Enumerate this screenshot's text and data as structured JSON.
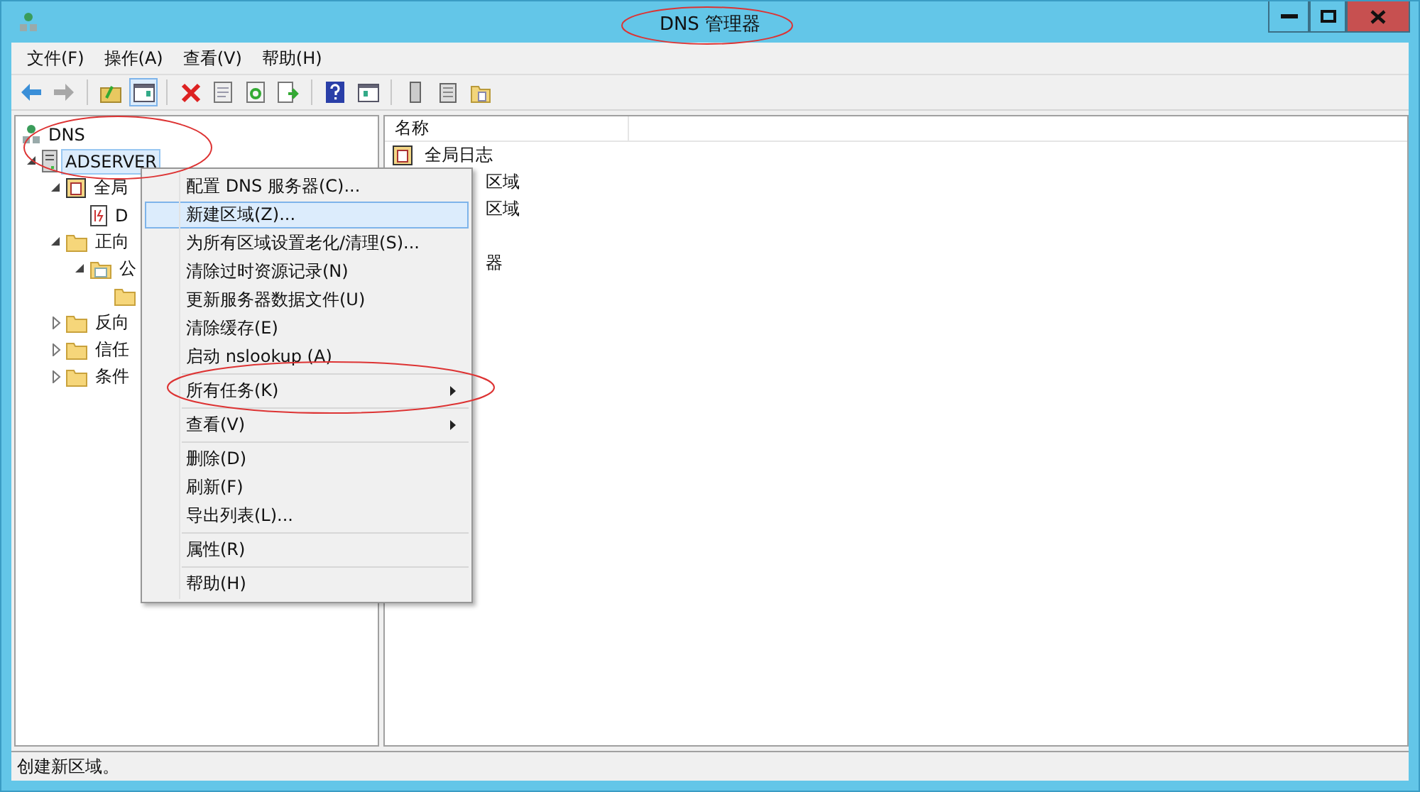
{
  "window": {
    "title": "DNS 管理器"
  },
  "menubar": [
    "文件(F)",
    "操作(A)",
    "查看(V)",
    "帮助(H)"
  ],
  "toolbar": [
    {
      "kind": "back",
      "disabled": false
    },
    {
      "kind": "forward",
      "disabled": true
    },
    {
      "kind": "sep"
    },
    {
      "kind": "up",
      "disabled": false
    },
    {
      "kind": "pane",
      "disabled": false,
      "selected": true
    },
    {
      "kind": "sep"
    },
    {
      "kind": "delete",
      "disabled": false
    },
    {
      "kind": "props",
      "disabled": false
    },
    {
      "kind": "refresh",
      "disabled": false
    },
    {
      "kind": "export",
      "disabled": false
    },
    {
      "kind": "sep"
    },
    {
      "kind": "help",
      "disabled": false
    },
    {
      "kind": "pane2",
      "disabled": false
    },
    {
      "kind": "sep"
    },
    {
      "kind": "server",
      "disabled": false
    },
    {
      "kind": "list",
      "disabled": false
    },
    {
      "kind": "folders",
      "disabled": false
    }
  ],
  "tree": [
    {
      "kind": "dns",
      "label": "DNS",
      "selected": false,
      "children": [
        {
          "kind": "server",
          "label": "ADSERVER",
          "selected": true,
          "expanded": true,
          "children": [
            {
              "kind": "log",
              "label": "全局",
              "expanded": true,
              "children": [
                {
                  "kind": "logfile",
                  "label": "D"
                }
              ]
            },
            {
              "kind": "folder",
              "label": "正向",
              "expanded": true,
              "children": [
                {
                  "kind": "zone",
                  "label": "公",
                  "expanded": true,
                  "children": [
                    {
                      "kind": "folder"
                    }
                  ]
                }
              ]
            },
            {
              "kind": "folder",
              "label": "反向",
              "expanded": false
            },
            {
              "kind": "folder",
              "label": "信任",
              "expanded": false
            },
            {
              "kind": "folder",
              "label": "条件",
              "expanded": false
            }
          ]
        }
      ]
    }
  ],
  "list": {
    "columns": [
      "名称"
    ],
    "rows": [
      {
        "kind": "log",
        "label": "全局日志"
      },
      {
        "kind": "none",
        "label": "区域"
      },
      {
        "kind": "none",
        "label": "区域"
      },
      {
        "kind": "gap"
      },
      {
        "kind": "none",
        "label": "器"
      }
    ]
  },
  "context_menu": [
    {
      "kind": "item",
      "label": "配置 DNS 服务器(C)...",
      "selected": false,
      "submenu": false
    },
    {
      "kind": "item",
      "label": "新建区域(Z)...",
      "selected": true,
      "submenu": false
    },
    {
      "kind": "item",
      "label": "为所有区域设置老化/清理(S)...",
      "selected": false,
      "submenu": false
    },
    {
      "kind": "item",
      "label": "清除过时资源记录(N)",
      "selected": false,
      "submenu": false
    },
    {
      "kind": "item",
      "label": "更新服务器数据文件(U)",
      "selected": false,
      "submenu": false
    },
    {
      "kind": "item",
      "label": "清除缓存(E)",
      "selected": false,
      "submenu": false
    },
    {
      "kind": "item",
      "label": "启动 nslookup (A)",
      "selected": false,
      "submenu": false
    },
    {
      "kind": "separator"
    },
    {
      "kind": "item",
      "label": "所有任务(K)",
      "selected": false,
      "submenu": true
    },
    {
      "kind": "separator"
    },
    {
      "kind": "item",
      "label": "查看(V)",
      "selected": false,
      "submenu": true
    },
    {
      "kind": "separator"
    },
    {
      "kind": "item",
      "label": "删除(D)",
      "selected": false,
      "submenu": false
    },
    {
      "kind": "item",
      "label": "刷新(F)",
      "selected": false,
      "submenu": false
    },
    {
      "kind": "item",
      "label": "导出列表(L)...",
      "selected": false,
      "submenu": false
    },
    {
      "kind": "separator"
    },
    {
      "kind": "item",
      "label": "属性(R)",
      "selected": false,
      "submenu": false
    },
    {
      "kind": "separator"
    },
    {
      "kind": "item",
      "label": "帮助(H)",
      "selected": false,
      "submenu": false
    }
  ],
  "status_bar": "创建新区域。"
}
